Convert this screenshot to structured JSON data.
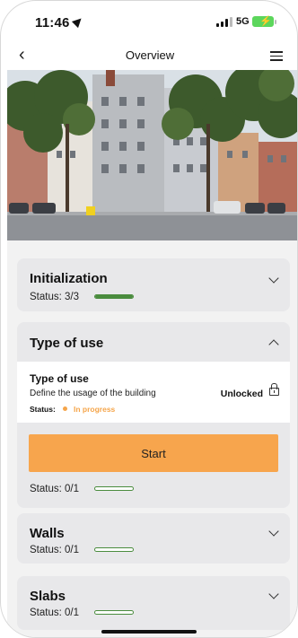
{
  "status_bar": {
    "time": "11:46",
    "network": "5G"
  },
  "nav": {
    "title": "Overview"
  },
  "colors": {
    "accent": "#f7a54d",
    "progress": "#4a8c3e",
    "status_in_progress": "#f5a54a"
  },
  "sections": [
    {
      "title": "Initialization",
      "status": "Status: 3/3",
      "progress": 1.0,
      "expanded": false
    },
    {
      "title": "Type of use",
      "status": "Status: 0/1",
      "progress": 0.0,
      "expanded": true,
      "task": {
        "title": "Type of use",
        "description": "Define the usage of the building",
        "status_label": "Status:",
        "status_value": "In progress",
        "lock_state": "Unlocked",
        "action_label": "Start"
      }
    },
    {
      "title": "Walls",
      "status": "Status: 0/1",
      "progress": 0.0,
      "expanded": false
    },
    {
      "title": "Slabs",
      "status": "Status: 0/1",
      "progress": 0.0,
      "expanded": false
    }
  ]
}
